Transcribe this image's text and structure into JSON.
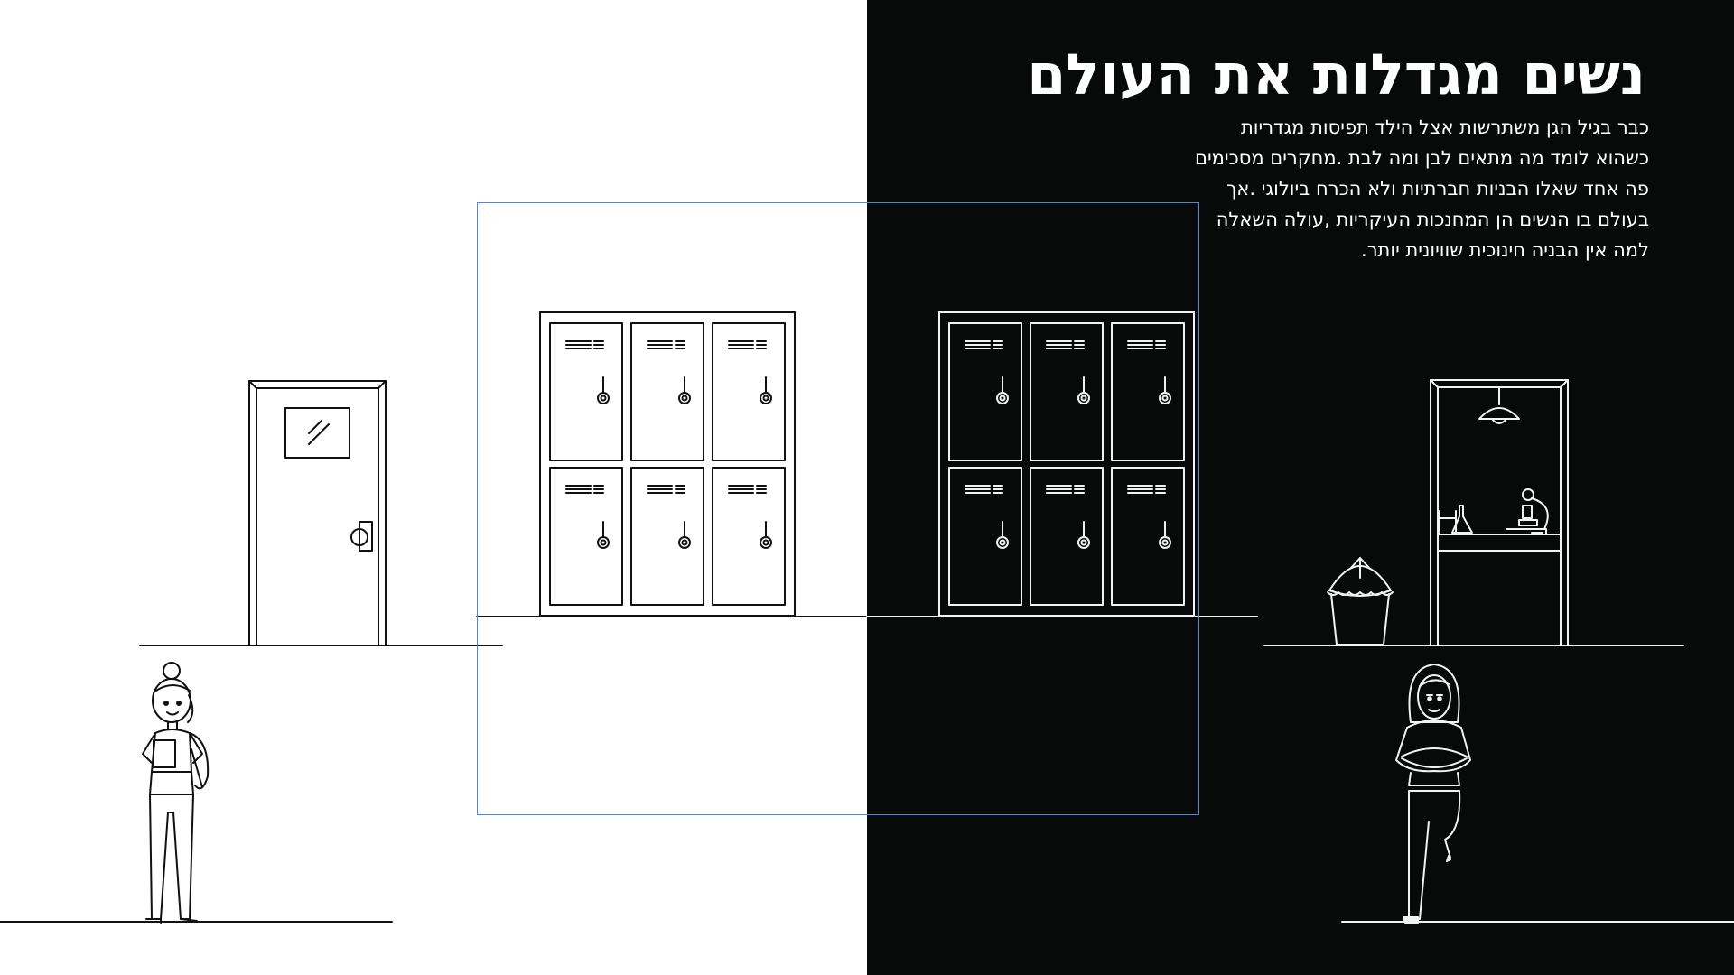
{
  "slide": {
    "title": "נשים מגדלות את העולם",
    "body_lines": [
      "כבר בגיל הגן משתרשות אצל הילד תפיסות מגדריות",
      "כשהוא לומד מה מתאים לבן ומה לבת .מחקרים מסכימים",
      "פה אחד שאלו הבניות חברתיות ולא הכרח ביולוגי .אך",
      "בעולם בו הנשים הן המחנכות העיקריות ,עולה השאלה",
      "למה אין הבניה חינוכית שוויונית יותר."
    ]
  },
  "colors": {
    "light_background": "#ffffff",
    "dark_background": "#080909",
    "selection_frame": "#4a8ad8"
  },
  "illustrations": {
    "left": [
      "classroom-door",
      "student-girl-with-books",
      "locker-bank"
    ],
    "right": [
      "locker-bank",
      "science-lab-doorway",
      "trash-bin",
      "hooded-student"
    ]
  }
}
